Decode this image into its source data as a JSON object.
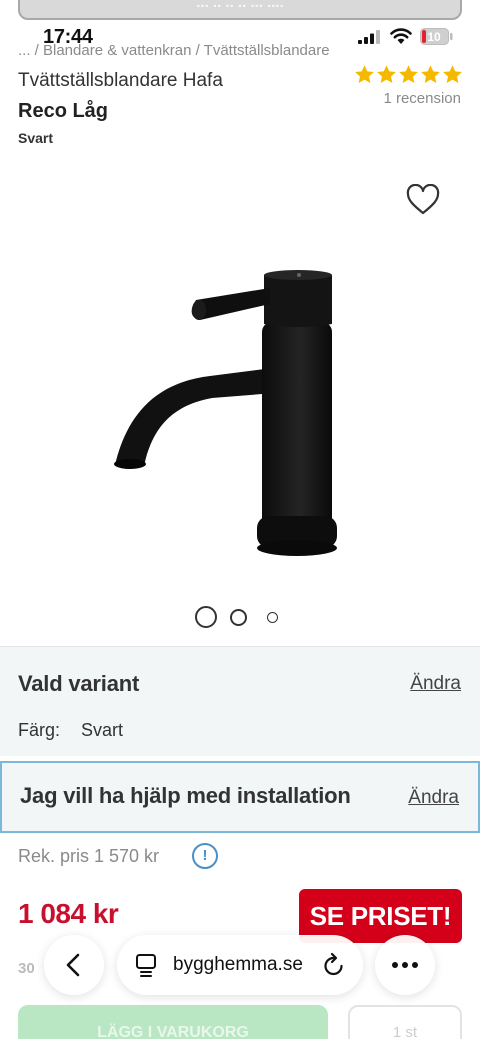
{
  "banner": {
    "text": "... .. .. .. ... ...."
  },
  "status_bar": {
    "time": "17:44",
    "battery": "10"
  },
  "breadcrumb": "... / Blandare & vattenkran / Tvättställsblandare",
  "product": {
    "title_line1": "Tvättställsblandare Hafa",
    "title_line2": "Reco Låg",
    "color": "Svart",
    "rating": 5,
    "review_count": "1 recension"
  },
  "gallery": {
    "dots": 3,
    "active_dot": 1
  },
  "variant": {
    "title": "Vald variant",
    "change_label": "Ändra",
    "color_label": "Färg:",
    "color_value": "Svart"
  },
  "installation": {
    "title": "Jag vill ha hjälp med installation",
    "change_label": "Ändra"
  },
  "pricing": {
    "rek_price": "Rek. pris 1 570 kr",
    "info_icon": "!",
    "price": "1 084 kr",
    "see_price_label": "SE PRISET!"
  },
  "obscured": {
    "below_price": "30",
    "cart_button": "LÄGG I VARUKORG",
    "quantity": "1 st"
  },
  "browser": {
    "url": "bygghemma.se"
  },
  "colors": {
    "price_red": "#c8102e",
    "button_red": "#d4001a",
    "install_border": "#7cb8d9",
    "star_yellow": "#f5b800",
    "info_blue": "#4a90c8"
  }
}
